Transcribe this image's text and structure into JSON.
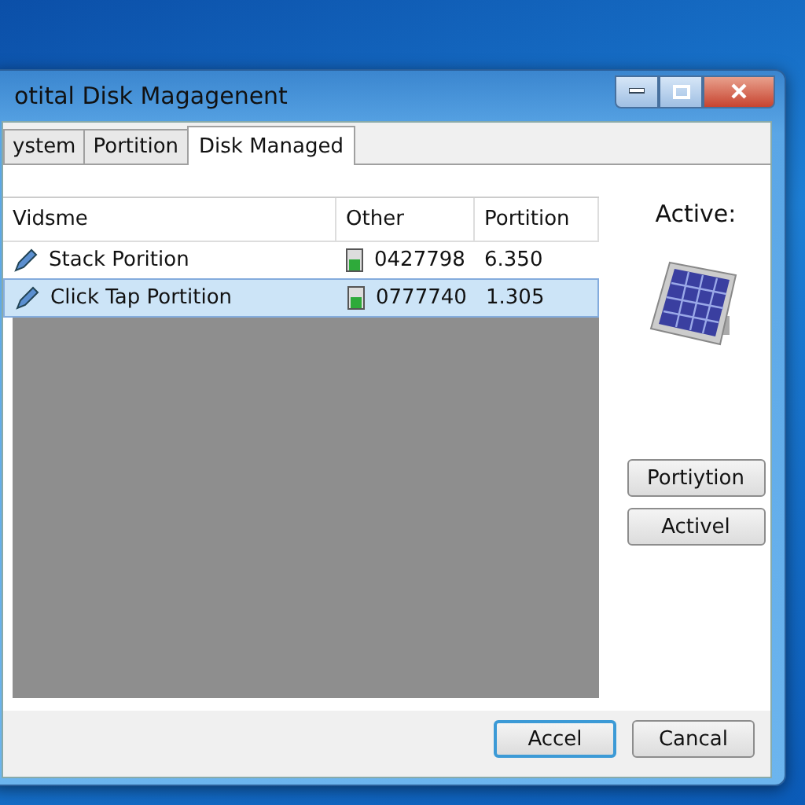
{
  "window": {
    "title": "otital Disk Magagenent"
  },
  "tabs": [
    {
      "label": "ystem",
      "selected": false
    },
    {
      "label": "Portition",
      "selected": false
    },
    {
      "label": "Disk Managed",
      "selected": true
    }
  ],
  "table": {
    "columns": [
      "Vidsme",
      "Other",
      "Portition"
    ],
    "rows": [
      {
        "name": "Stack Porition",
        "other": "0427798",
        "portition": "6.350",
        "selected": false
      },
      {
        "name": "Click Tap Portition",
        "other": "0777740",
        "portition": "1.305",
        "selected": true
      }
    ]
  },
  "side_panel": {
    "label": "Active:",
    "buttons": [
      "Portiytion",
      "Activel"
    ]
  },
  "footer_buttons": [
    {
      "label": "Accel",
      "default": true
    },
    {
      "label": "Cancal",
      "default": false
    }
  ]
}
